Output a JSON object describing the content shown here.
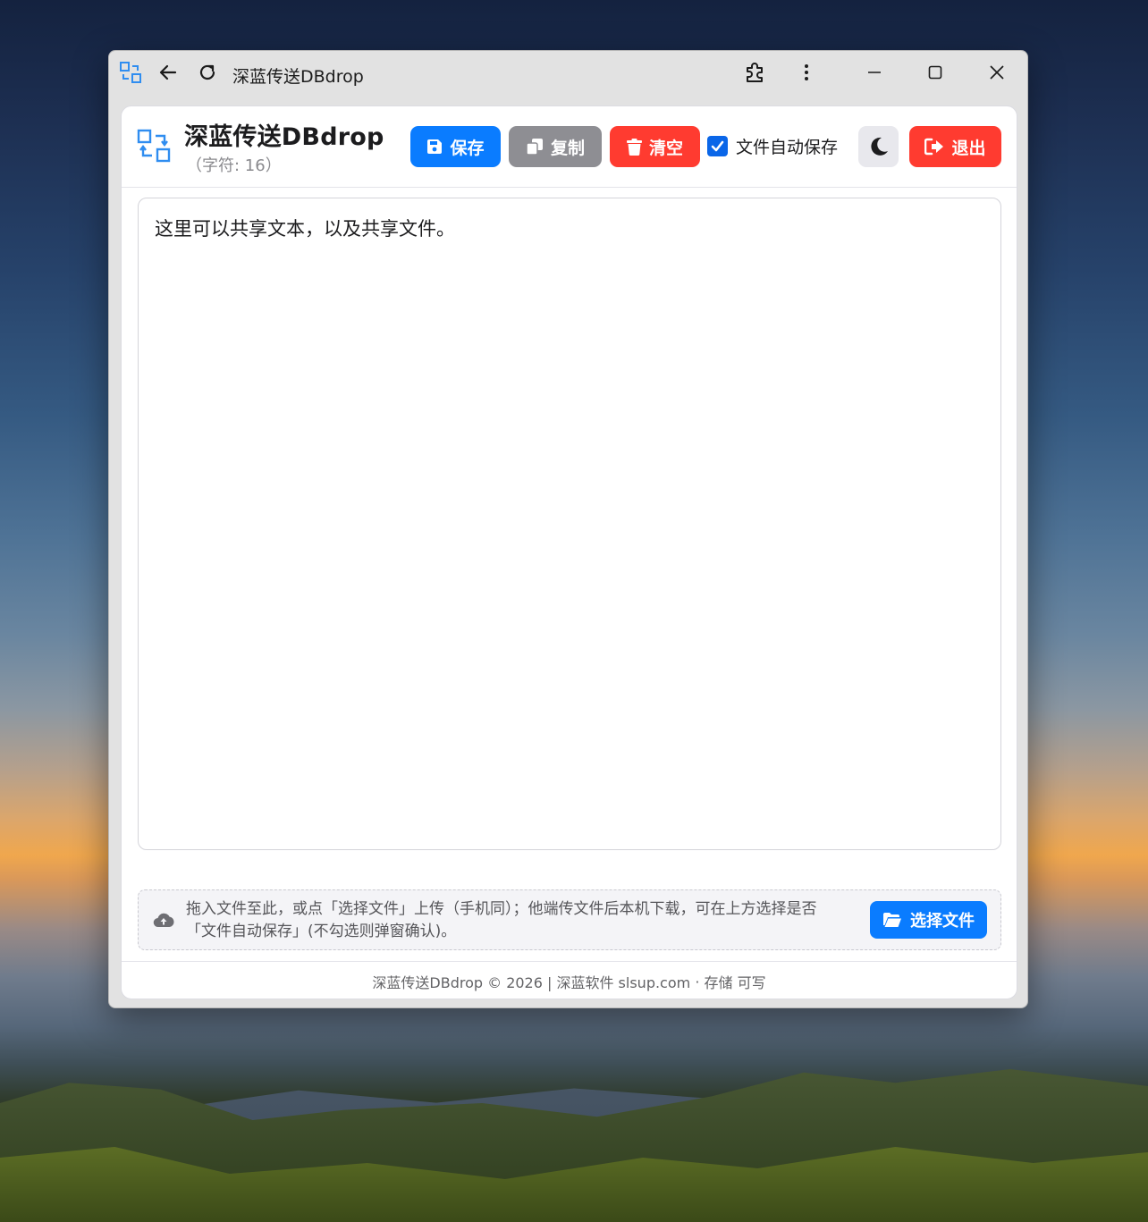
{
  "browser": {
    "title": "深蓝传送DBdrop",
    "icons": [
      "app-icon",
      "back-icon",
      "reload-icon",
      "extensions-icon",
      "more-vert-icon",
      "minimize-icon",
      "maximize-icon",
      "close-icon"
    ]
  },
  "header": {
    "title": "深蓝传送DBdrop",
    "char_count": "（字符: 16）",
    "save_label": "保存",
    "copy_label": "复制",
    "clear_label": "清空",
    "autosave_label": "文件自动保存",
    "autosave_checked": true,
    "exit_label": "退出"
  },
  "editor": {
    "text": "这里可以共享文本，以及共享文件。"
  },
  "dropzone": {
    "line1": "拖入文件至此，或点「选择文件」上传（手机同）；他端传文件后本机下载，可在上方选择是否",
    "line2": "「文件自动保存」(不勾选则弹窗确认)。",
    "choose_label": "选择文件"
  },
  "footer": {
    "copyright": "深蓝传送DBdrop © 2026 | 深蓝软件 slsup.com",
    "separator": " · ",
    "status": "存储 可写"
  },
  "colors": {
    "primary": "#0a7cff",
    "secondary": "#8e8e93",
    "danger": "#ff3b30",
    "logo": "#2f8df0"
  }
}
